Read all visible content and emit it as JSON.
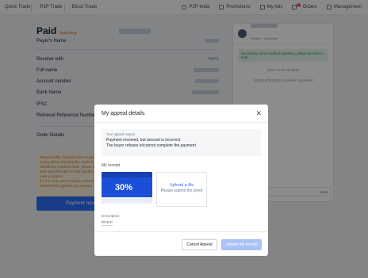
{
  "topbar": {
    "nav": [
      "Quick Trade",
      "P2P Trade",
      "Block Trade"
    ],
    "p2p_region": "P2P India",
    "promotions": "Promotions",
    "my_ads": "My Ads",
    "orders": "Orders",
    "orders_badge": "1",
    "management": "Management"
  },
  "order": {
    "status": "Paid",
    "status_sub": "Appealing",
    "payer_name_label": "Payer's Name",
    "receive_with_label": "Receive with",
    "receive_with_value": "IMPS",
    "full_name_label": "Full name",
    "account_number_label": "Account number",
    "bank_name_label": "Bank Name",
    "ifsc_label": "IFSC",
    "retrieval_ref_label": "Retrieval Reference Number",
    "order_details_label": "Order Details",
    "tips": [
      "Please double check you have received the money before releasing the crypto to avoid",
      "Should any questions arise, please contact the other party through the chat interface, or you can raise an appeal",
      "If it is a scam and no crypto received, do not transfer their crypto to your account"
    ],
    "payment_button": "Payment received"
  },
  "chat": {
    "verified": "Verified",
    "advertiser": "Advertiser",
    "notice": "Secured by OKX's verified advertiser, please feel free to trade",
    "timestamp": "2024-12-02 16:09:30",
    "system_msg": "1912014/0621186 Complete! submitted",
    "input_placeholder": "Type here...",
    "send": "Send"
  },
  "modal": {
    "title": "My appeal details",
    "reason_label": "Your appeal reason",
    "reason_lines": [
      "Payment received, but amount is incorrect",
      "The buyer refuses to/cannot complete the payment"
    ],
    "receipt_label": "My receipt",
    "thumb_text": "30%",
    "upload_title": "Upload a file",
    "upload_sub": "Please submit the proof",
    "description_label": "Description",
    "description_value": "testuri",
    "cancel_button": "Cancel Appeal",
    "upload_button": "Upload the receipt"
  }
}
